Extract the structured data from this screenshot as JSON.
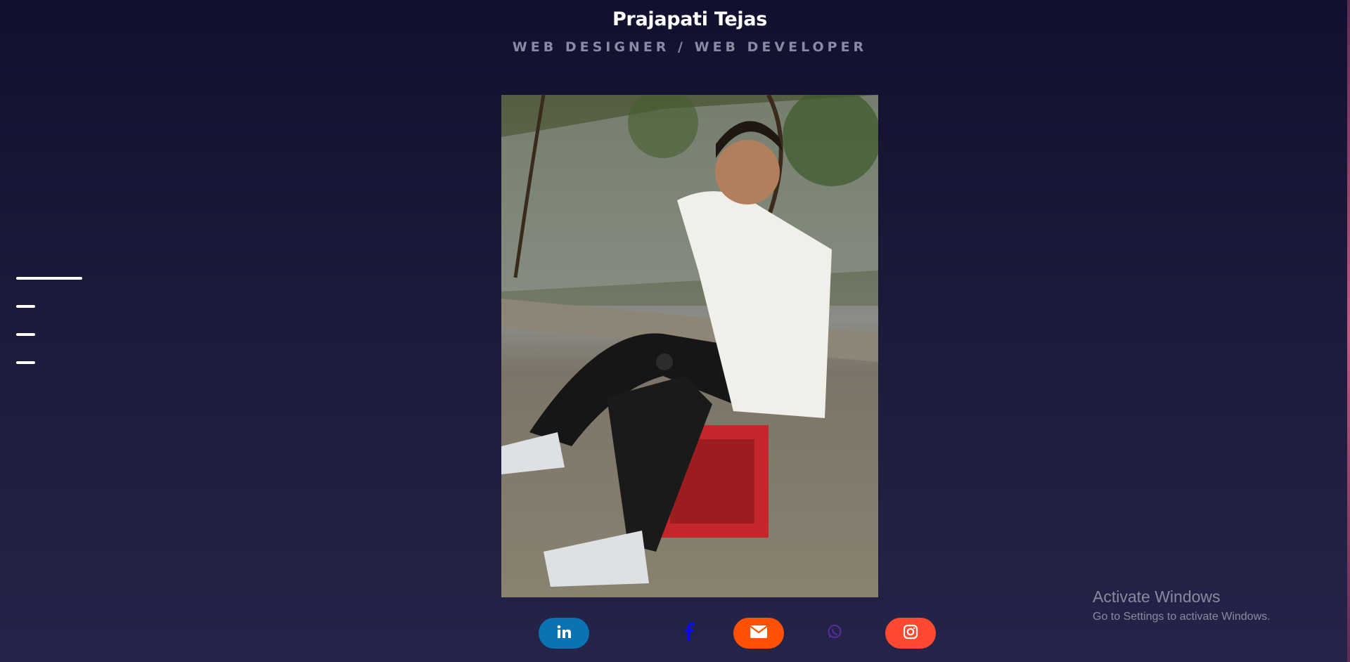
{
  "header": {
    "name": "Prajapati Tejas",
    "role": "WEB DESIGNER / WEB DEVELOPER"
  },
  "side_nav": {
    "items": [
      "menu-line-1",
      "menu-line-2",
      "menu-line-3",
      "menu-line-4"
    ]
  },
  "photo": {
    "subject": "portrait-photo"
  },
  "socials": [
    {
      "name": "linkedin",
      "icon": "linkedin-icon",
      "color": "#0a73b1"
    },
    {
      "name": "facebook",
      "icon": "facebook-icon",
      "color": "#0a06ff"
    },
    {
      "name": "email",
      "icon": "envelope-icon",
      "color": "#ff5106"
    },
    {
      "name": "whatsapp",
      "icon": "whatsapp-icon",
      "color": "#5b2a9b"
    },
    {
      "name": "instagram",
      "icon": "instagram-icon",
      "color": "#ff4a31"
    }
  ],
  "watermark": {
    "title": "Activate Windows",
    "subtitle": "Go to Settings to activate Windows."
  }
}
